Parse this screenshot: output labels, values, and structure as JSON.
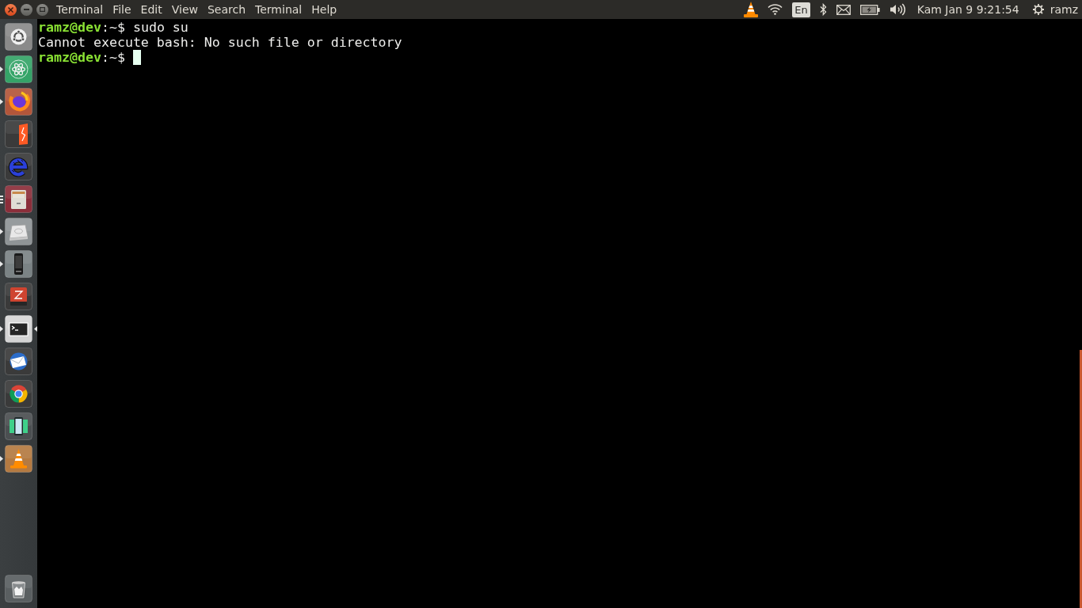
{
  "top_bar": {
    "window_buttons": [
      {
        "kind": "close"
      },
      {
        "kind": "minimize"
      },
      {
        "kind": "maximize"
      }
    ],
    "menu": [
      "Terminal",
      "File",
      "Edit",
      "View",
      "Search",
      "Terminal",
      "Help"
    ],
    "indicators": [
      {
        "kind": "cone"
      },
      {
        "kind": "wifi"
      },
      {
        "kind": "keyboard",
        "label": "En"
      },
      {
        "kind": "bluetooth"
      },
      {
        "kind": "mail"
      },
      {
        "kind": "battery"
      },
      {
        "kind": "volume"
      }
    ],
    "clock": "Kam Jan 9 9:21:54",
    "user": "ramz"
  },
  "launcher": {
    "items": [
      {
        "kind": "dash",
        "running": false,
        "multiple_windows": false,
        "focused": false
      },
      {
        "kind": "atom",
        "running": true,
        "multiple_windows": false,
        "focused": false
      },
      {
        "kind": "browser",
        "running": true,
        "multiple_windows": false,
        "focused": false
      },
      {
        "kind": "document",
        "running": false,
        "multiple_windows": false,
        "focused": false
      },
      {
        "kind": "letter_e",
        "running": false,
        "multiple_windows": false,
        "focused": false
      },
      {
        "kind": "cabinet",
        "running": true,
        "multiple_windows": true,
        "focused": false
      },
      {
        "kind": "drive",
        "running": true,
        "multiple_windows": false,
        "focused": false
      },
      {
        "kind": "phone",
        "running": true,
        "multiple_windows": false,
        "focused": false
      },
      {
        "kind": "book",
        "running": false,
        "multiple_windows": false,
        "focused": false
      },
      {
        "kind": "terminal",
        "running": true,
        "multiple_windows": false,
        "focused": true
      },
      {
        "kind": "mail",
        "running": false,
        "multiple_windows": false,
        "focused": false
      },
      {
        "kind": "wheel",
        "running": false,
        "multiple_windows": false,
        "focused": false
      },
      {
        "kind": "tablet",
        "running": false,
        "multiple_windows": false,
        "focused": false
      },
      {
        "kind": "cone",
        "running": true,
        "multiple_windows": false,
        "focused": false
      },
      {
        "kind": "trash",
        "running": false,
        "multiple_windows": false,
        "focused": false
      }
    ]
  },
  "terminal": {
    "lines": [
      {
        "kind": "prompt",
        "user_host": "ramz@dev",
        "sigil": ":~$",
        "command": "sudo su",
        "cursor": false
      },
      {
        "kind": "output",
        "text": "Cannot execute bash: No such file or directory"
      },
      {
        "kind": "prompt",
        "user_host": "ramz@dev",
        "sigil": ":~$",
        "cursor": true
      }
    ]
  }
}
